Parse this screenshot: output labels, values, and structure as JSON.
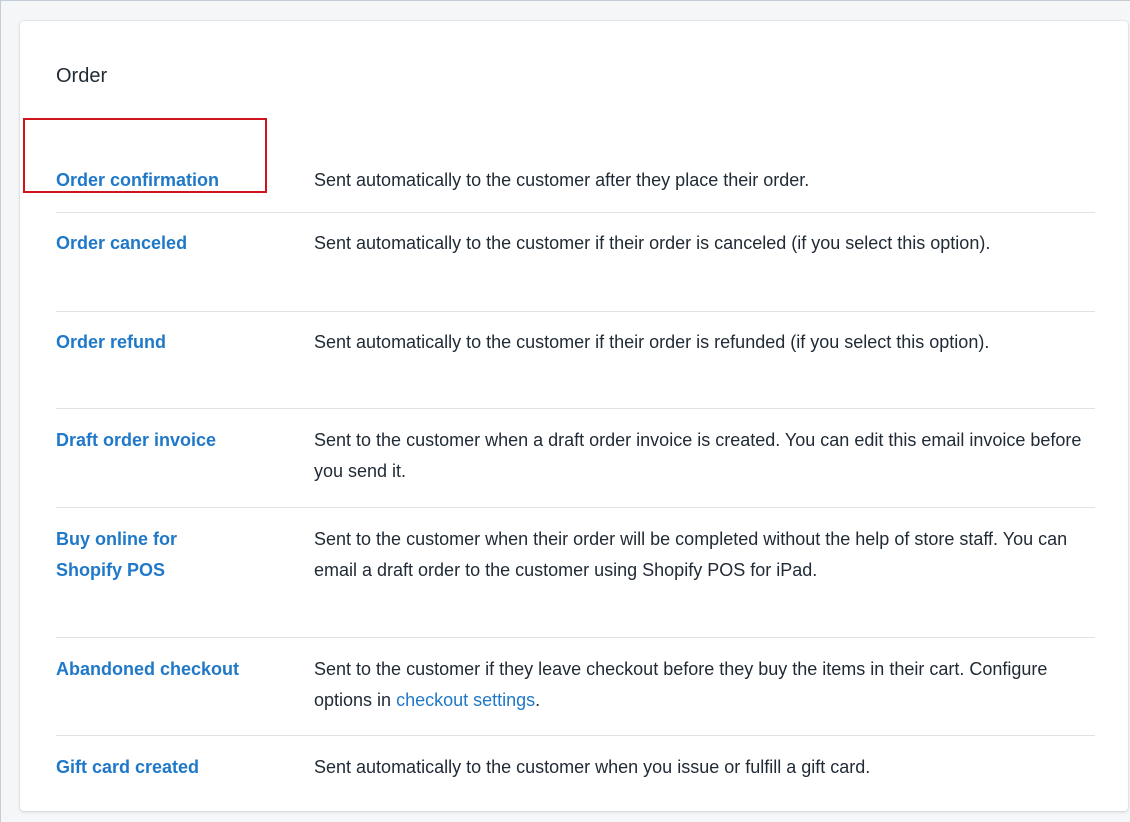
{
  "section": {
    "title": "Order"
  },
  "rows": [
    {
      "name": "Order confirmation",
      "description": "Sent automatically to the customer after they place their order."
    },
    {
      "name": "Order canceled",
      "description": "Sent automatically to the customer if their order is canceled (if you select this option)."
    },
    {
      "name": "Order refund",
      "description": "Sent automatically to the customer if their order is refunded (if you select this option)."
    },
    {
      "name": "Draft order invoice",
      "description": "Sent to the customer when a draft order invoice is created. You can edit this email invoice before you send it."
    },
    {
      "name": "Buy online for Shopify POS",
      "description": "Sent to the customer when their order will be completed without the help of store staff. You can email a draft order to the customer using Shopify POS for iPad."
    },
    {
      "name": "Abandoned checkout",
      "description_before_link": "Sent to the customer if they leave checkout before they buy the items in their cart. Configure options in ",
      "description_link": "checkout settings",
      "description_after_link": "."
    },
    {
      "name": "Gift card created",
      "description": "Sent automatically to the customer when you issue or fulfill a gift card."
    }
  ],
  "colors": {
    "link": "#1f78c8",
    "highlight": "#d0141c"
  }
}
